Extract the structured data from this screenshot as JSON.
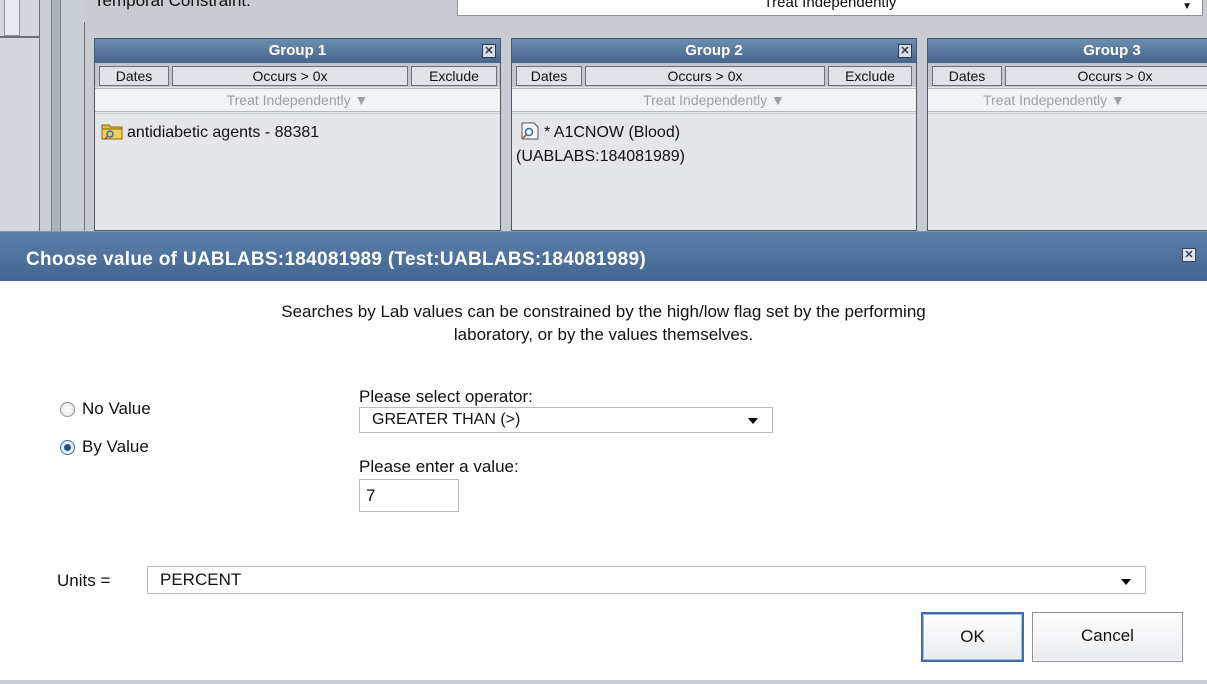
{
  "query_panel": {
    "temporal_label": "Temporal Constraint:",
    "temporal_value": "Treat Independently",
    "groups": [
      {
        "title": "Group 1",
        "dates": "Dates",
        "occurs": "Occurs > 0x",
        "exclude": "Exclude",
        "treat": "Treat Independently ▼",
        "concept_line1": "antidiabetic agents - 88381",
        "concept_line2": "",
        "concept_icon": "folder-icon"
      },
      {
        "title": "Group 2",
        "dates": "Dates",
        "occurs": "Occurs > 0x",
        "exclude": "Exclude",
        "treat": "Treat Independently ▼",
        "concept_line1": "* A1CNOW (Blood)",
        "concept_line2": "(UABLABS:184081989)",
        "concept_icon": "lab-leaf-icon"
      },
      {
        "title": "Group 3",
        "dates": "Dates",
        "occurs": "Occurs > 0x",
        "exclude": "",
        "treat": "Treat Independently ▼",
        "concept_line1": "",
        "concept_line2": "",
        "concept_icon": ""
      }
    ]
  },
  "dialog": {
    "title": "Choose value of UABLABS:184081989 (Test:UABLABS:184081989)",
    "close_icon": "close-icon",
    "intro_line1": "Searches by Lab values can be constrained by the high/low flag set by the performing",
    "intro_line2": "laboratory, or by the values themselves.",
    "radio_no_value": "No Value",
    "radio_by_value": "By Value",
    "selected_mode": "By Value",
    "operator_label": "Please select operator:",
    "operator_value": "GREATER THAN (>)",
    "value_label": "Please enter a value:",
    "value": "7",
    "units_label": "Units =",
    "units_value": "PERCENT",
    "ok_label": "OK",
    "cancel_label": "Cancel"
  },
  "colors": {
    "title_bar": "#4b6f99",
    "group_header": "#5a7aa0",
    "ok_border": "#3d6fa6"
  }
}
